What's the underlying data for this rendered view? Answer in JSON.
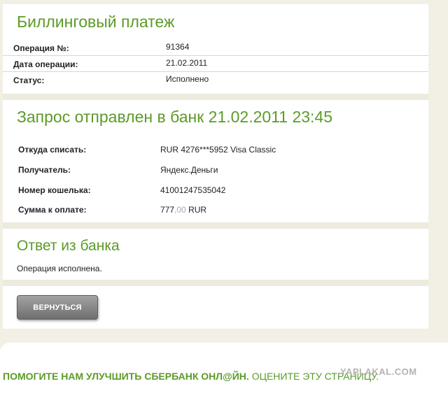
{
  "billing": {
    "title": "Биллинговый платеж",
    "rows": [
      {
        "label": "Операция №:",
        "value": "91364"
      },
      {
        "label": "Дата операции:",
        "value": "21.02.2011"
      },
      {
        "label": "Статус:",
        "value": "Исполнено"
      }
    ]
  },
  "request": {
    "title": "Запрос отправлен в банк 21.02.2011 23:45",
    "rows": [
      {
        "label": "Откуда списать:",
        "value": "RUR 4276***5952 Visa Classic"
      },
      {
        "label": "Получатель:",
        "value": "Яндекс.Деньги"
      },
      {
        "label": "Номер кошелька:",
        "value": "41001247535042"
      }
    ],
    "amount": {
      "label": "Сумма к оплате:",
      "main": "777",
      "cents": ",00",
      "currency": "RUR"
    }
  },
  "response": {
    "title": "Ответ из банка",
    "text": "Операция исполнена."
  },
  "back_button": {
    "label": "ВЕРНУТЬСЯ"
  },
  "footer": {
    "improve": "ПОМОГИТЕ НАМ УЛУЧШИТЬ СБЕРБАНК ОНЛ@ЙН.",
    "rate": "ОЦЕНИТЕ ЭТУ СТРАНИЦУ."
  },
  "watermark": "YAPLAKAL.COM",
  "colors": {
    "accent": "#5b9b27",
    "frame": "#f2f0e4",
    "separator": "#ecebde",
    "button": "#8a8a8a"
  }
}
